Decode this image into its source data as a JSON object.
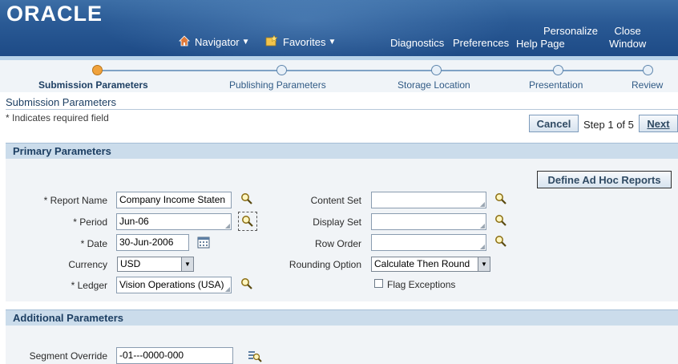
{
  "header": {
    "logo": "ORACLE",
    "navigator": "Navigator",
    "favorites": "Favorites",
    "diagnostics": "Diagnostics",
    "preferences": "Preferences",
    "personalize": "Personalize",
    "help_page": "Help Page",
    "close": "Close",
    "window": "Window"
  },
  "train": {
    "steps": [
      "Submission Parameters",
      "Publishing Parameters",
      "Storage Location",
      "Presentation",
      "Review"
    ],
    "active_index": 0
  },
  "page": {
    "title": "Submission Parameters",
    "required_note": "* Indicates required field",
    "cancel": "Cancel",
    "step_text": "Step 1 of 5",
    "next": "Next"
  },
  "primary": {
    "title": "Primary Parameters",
    "define_button": "Define Ad Hoc Reports",
    "report_name_label": "* Report Name",
    "report_name_value": "Company Income Staten",
    "period_label": "* Period",
    "period_value": "Jun-06",
    "date_label": "* Date",
    "date_value": "30-Jun-2006",
    "currency_label": "Currency",
    "currency_value": "USD",
    "ledger_label": "* Ledger",
    "ledger_value": "Vision Operations (USA)",
    "content_set_label": "Content Set",
    "content_set_value": "",
    "display_set_label": "Display Set",
    "display_set_value": "",
    "row_order_label": "Row Order",
    "row_order_value": "",
    "rounding_label": "Rounding Option",
    "rounding_value": "Calculate Then Round",
    "flag_label": "Flag Exceptions"
  },
  "additional": {
    "title": "Additional Parameters",
    "segment_label": "Segment Override",
    "segment_value": "-01---0000-000"
  },
  "colors": {
    "header_blue": "#2a5a95",
    "section_header": "#cbdceb",
    "active_step": "#f0a23c"
  }
}
